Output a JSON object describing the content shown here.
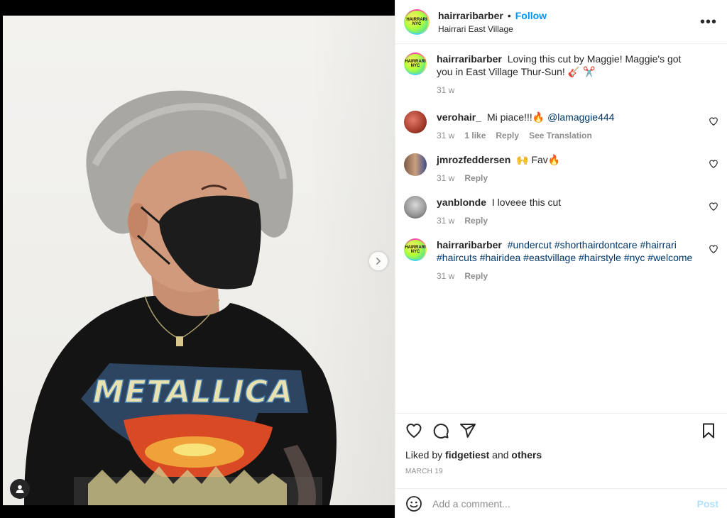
{
  "header": {
    "username": "hairraribarber",
    "separator": "•",
    "follow_label": "Follow",
    "location": "Hairrari East Village",
    "more_label": "•••"
  },
  "logo": {
    "line1": "HAIRRARI",
    "line2": "NYC"
  },
  "caption": {
    "username": "hairraribarber",
    "text": "Loving this cut by Maggie! Maggie's got you in East Village Thur-Sun! 🎸 ✂️",
    "time": "31 w"
  },
  "comments": [
    {
      "username": "verohair_",
      "text": "Mi piace!!!🔥",
      "mention": "@lamaggie444",
      "time": "31 w",
      "likes": "1 like",
      "reply": "Reply",
      "translate": "See Translation"
    },
    {
      "username": "jmrozfeddersen",
      "text": "🙌 Fav🔥",
      "time": "31 w",
      "reply": "Reply"
    },
    {
      "username": "yanblonde",
      "text": "I loveee this cut",
      "time": "31 w",
      "reply": "Reply"
    },
    {
      "username": "hairraribarber",
      "hashtags_line1": "#undercut #shorthairdontcare #hairrari",
      "hashtags_line2": "#haircuts #hairidea #eastvillage #hairstyle #nyc #welcome",
      "time": "31 w",
      "reply": "Reply"
    }
  ],
  "likes": {
    "prefix": "Liked by",
    "user": "fidgetiest",
    "conj": "and",
    "others": "others"
  },
  "date": "MARCH 19",
  "add_comment": {
    "placeholder": "Add a comment...",
    "post_label": "Post"
  },
  "photo": {
    "shirt_text": "METALLICA"
  },
  "colors": {
    "accent": "#0095f6",
    "link": "#00376b",
    "muted": "#8e8e8e",
    "post_disabled": "#b2dffc"
  }
}
